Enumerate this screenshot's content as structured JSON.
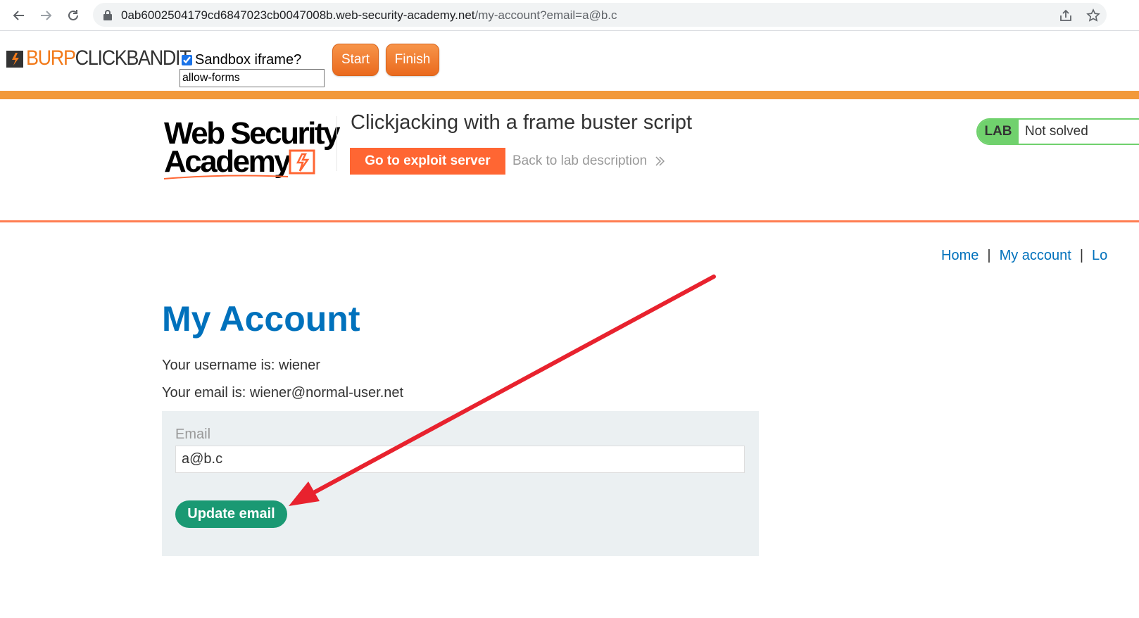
{
  "browser": {
    "url_host": "0ab6002504179cd6847023cb0047008b.web-security-academy.net",
    "url_path": "/my-account?email=a@b.c"
  },
  "clickbandit": {
    "logo_burp": "BURP",
    "logo_rest": "CLICKBANDIT",
    "sandbox_label": "Sandbox iframe?",
    "sandbox_checked": true,
    "sandbox_value": "allow-forms",
    "start_label": "Start",
    "finish_label": "Finish",
    "accent_color": "#f2993a"
  },
  "lab": {
    "logo_line1": "Web Security",
    "logo_line2": "Academy",
    "title": "Clickjacking with a frame buster script",
    "exploit_button": "Go to exploit server",
    "back_link": "Back to lab description",
    "badge_label": "LAB",
    "badge_status": "Not solved",
    "brand_color": "#ff6633",
    "badge_color": "#70d16d"
  },
  "top_nav": {
    "home": "Home",
    "separator": "|",
    "my_account": "My account",
    "logout": "Lo"
  },
  "account": {
    "heading": "My Account",
    "username_text": "Your username is: wiener",
    "email_text": "Your email is: wiener@normal-user.net",
    "email_label": "Email",
    "email_value": "a@b.c",
    "update_button": "Update email",
    "button_color": "#1a9973"
  },
  "annotation": {
    "arrow_color": "#e8222e"
  }
}
